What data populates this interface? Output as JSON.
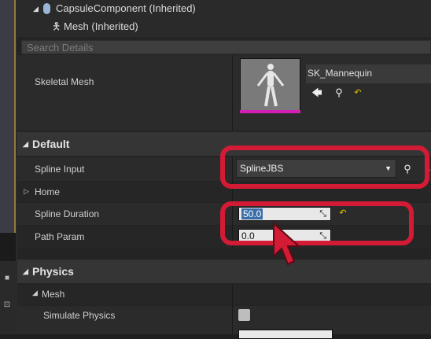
{
  "tree": {
    "capsule_label": "CapsuleComponent (Inherited)",
    "mesh_label": "Mesh (Inherited)"
  },
  "search": {
    "placeholder": "Search Details"
  },
  "skeletal_mesh": {
    "label": "Skeletal Mesh",
    "asset_name": "SK_Mannequin"
  },
  "default_category": {
    "title": "Default",
    "spline_input_label": "Spline Input",
    "spline_input_value": "SplineJBS",
    "home_label": "Home",
    "spline_duration_label": "Spline Duration",
    "spline_duration_value": "50.0",
    "path_param_label": "Path Param",
    "path_param_value": "0.0"
  },
  "physics_category": {
    "title": "Physics",
    "mesh_subcategory": "Mesh",
    "simulate_physics_label": "Simulate Physics",
    "simulate_physics_checked": false
  },
  "colors": {
    "highlight": "#d41b36",
    "accent_magenta": "#d21fb4",
    "reset_arrow": "#e3c200"
  },
  "icons": {
    "expand": "triangle-down-icon",
    "collapsed": "triangle-right-icon",
    "use_selected": "arrow-left-icon",
    "browse": "magnifier-icon",
    "reset": "reset-arrow-icon"
  }
}
